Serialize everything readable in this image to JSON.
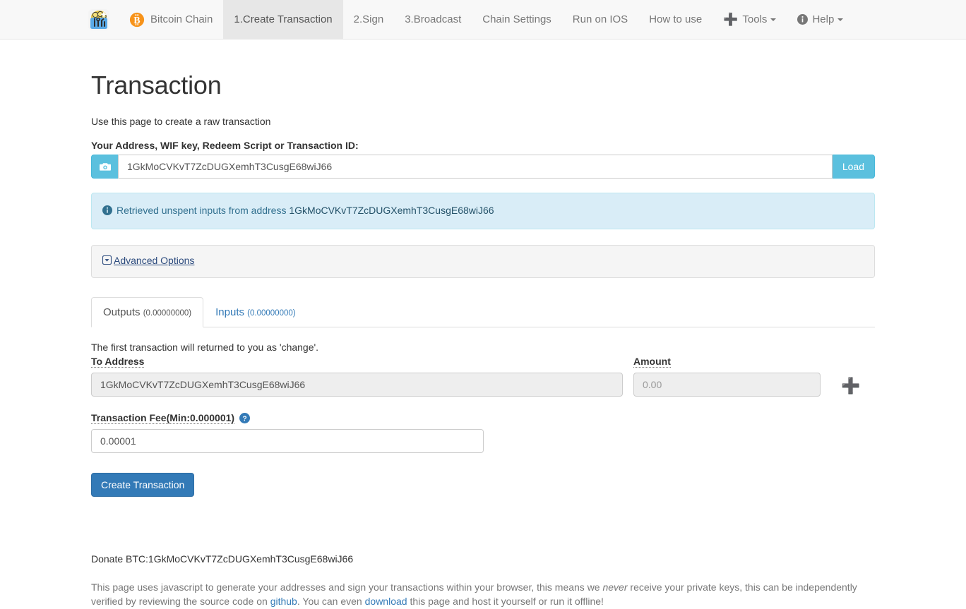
{
  "nav": {
    "brand_icon": "toolbox-money-icon",
    "items": [
      {
        "label": "Bitcoin Chain",
        "icon": "bitcoin-logo-icon",
        "active": false,
        "name": "nav-item-bitcoin-chain"
      },
      {
        "label": "1.Create Transaction",
        "icon": null,
        "active": true,
        "name": "nav-item-create-transaction"
      },
      {
        "label": "2.Sign",
        "icon": null,
        "active": false,
        "name": "nav-item-sign"
      },
      {
        "label": "3.Broadcast",
        "icon": null,
        "active": false,
        "name": "nav-item-broadcast"
      },
      {
        "label": "Chain Settings",
        "icon": null,
        "active": false,
        "name": "nav-item-chain-settings"
      },
      {
        "label": "Run on IOS",
        "icon": null,
        "active": false,
        "name": "nav-item-run-on-ios"
      },
      {
        "label": "How to use",
        "icon": null,
        "active": false,
        "name": "nav-item-how-to-use"
      },
      {
        "label": "Tools",
        "icon": "plus-icon",
        "caret": true,
        "active": false,
        "name": "nav-item-tools"
      },
      {
        "label": "Help",
        "icon": "info-circle-icon",
        "caret": true,
        "active": false,
        "name": "nav-item-help"
      }
    ]
  },
  "page": {
    "title": "Transaction",
    "lead": "Use this page to create a raw transaction"
  },
  "address_form": {
    "label": "Your Address, WIF key, Redeem Script or Transaction ID:",
    "camera_icon": "camera-icon",
    "value": "1GkMoCVKvT7ZcDUGXemhT3CusgE68wiJ66",
    "placeholder": "",
    "load_label": "Load"
  },
  "alert": {
    "icon": "info-circle-icon",
    "text": "Retrieved unspent inputs from address ",
    "address": "1GkMoCVKvT7ZcDUGXemhT3CusgE68wiJ66"
  },
  "advanced": {
    "icon": "caret-square-down-icon",
    "label": "Advanced Options"
  },
  "tabs": [
    {
      "label": "Outputs",
      "amount": "(0.00000000)",
      "active": true,
      "name": "tab-outputs"
    },
    {
      "label": "Inputs",
      "amount": "(0.00000000)",
      "active": false,
      "name": "tab-inputs"
    }
  ],
  "outputs": {
    "hint": "The first transaction will returned to you as 'change'.",
    "to_address_label": "To Address",
    "to_address_value": "1GkMoCVKvT7ZcDUGXemhT3CusgE68wiJ66",
    "amount_label": "Amount",
    "amount_value": "",
    "amount_placeholder": "0.00",
    "add_output_icon": "plus-icon"
  },
  "fee": {
    "label": "Transaction Fee(Min:0.000001)",
    "help_icon": "question-circle-icon",
    "value": "0.00001",
    "placeholder": ""
  },
  "actions": {
    "create_transaction_label": "Create Transaction"
  },
  "footer": {
    "donate": "Donate BTC:1GkMoCVKvT7ZcDUGXemhT3CusgE68wiJ66",
    "note_part1": "This page uses javascript to generate your addresses and sign your transactions within your browser, this means we ",
    "note_em": "never",
    "note_part2": " receive your private keys, this can be independently verified by reviewing the source code on ",
    "link_github": "github",
    "note_part3": ". You can even ",
    "link_download": "download",
    "note_part4": " this page and host it yourself or run it offline!"
  },
  "colors": {
    "navbar_bg": "#f8f8f8",
    "active_tab_bg": "#e7e7e7",
    "info_cyan": "#5bc0de",
    "alert_bg": "#d9edf7",
    "alert_text": "#31708f",
    "primary_blue": "#337ab7",
    "bitcoin_orange": "#f7931a"
  }
}
